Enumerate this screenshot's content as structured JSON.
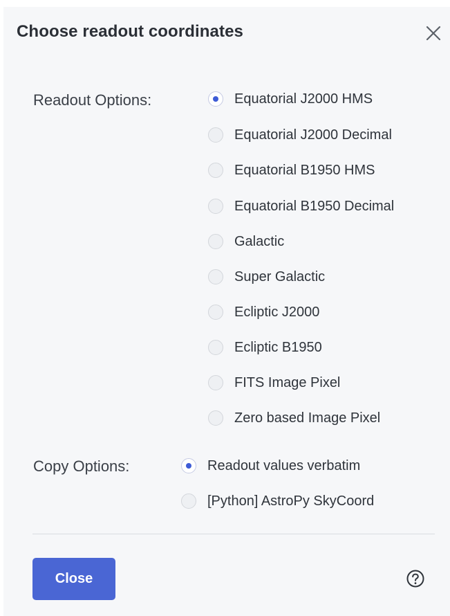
{
  "dialog": {
    "title": "Choose readout coordinates",
    "close_icon": "close-icon",
    "help_icon": "help-icon",
    "close_button_label": "Close"
  },
  "readout": {
    "label": "Readout Options:",
    "selected": "Equatorial J2000 HMS",
    "options": [
      {
        "label": "Equatorial J2000 HMS",
        "checked": true
      },
      {
        "label": "Equatorial J2000 Decimal",
        "checked": false
      },
      {
        "label": "Equatorial B1950 HMS",
        "checked": false
      },
      {
        "label": "Equatorial B1950 Decimal",
        "checked": false
      },
      {
        "label": "Galactic",
        "checked": false
      },
      {
        "label": "Super Galactic",
        "checked": false
      },
      {
        "label": "Ecliptic J2000",
        "checked": false
      },
      {
        "label": "Ecliptic B1950",
        "checked": false
      },
      {
        "label": "FITS Image Pixel",
        "checked": false
      },
      {
        "label": "Zero based Image Pixel",
        "checked": false
      }
    ]
  },
  "copy": {
    "label": "Copy Options:",
    "selected": "Readout values verbatim",
    "options": [
      {
        "label": "Readout values verbatim",
        "checked": true
      },
      {
        "label": "[Python] AstroPy SkyCoord",
        "checked": false
      }
    ]
  },
  "colors": {
    "accent": "#3d5bd6",
    "button": "#4a66d4",
    "dialog_bg": "#f6f7f9"
  }
}
